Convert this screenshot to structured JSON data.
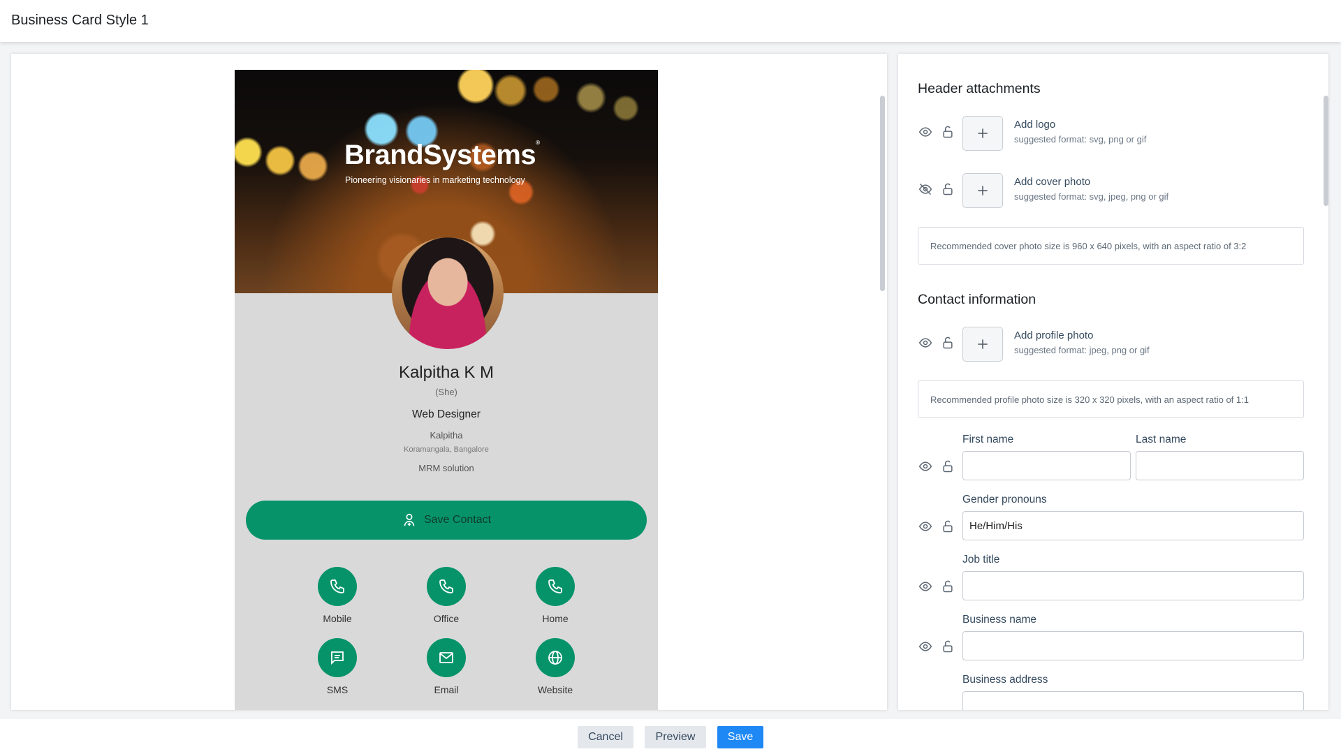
{
  "app": {
    "title": "Business Card Style 1"
  },
  "card": {
    "brand_name": "BrandSystems",
    "brand_mark": "®",
    "tagline": "Pioneering visionaries in marketing technology",
    "name": "Kalpitha K M",
    "pronouns": "(She)",
    "job_title": "Web Designer",
    "business": "Kalpitha",
    "address": "Koramangala, Bangalore",
    "department": "MRM solution",
    "save_contact": "Save Contact",
    "accent_color": "#07936a",
    "actions": [
      {
        "label": "Mobile",
        "icon": "phone-icon"
      },
      {
        "label": "Office",
        "icon": "phone-icon"
      },
      {
        "label": "Home",
        "icon": "phone-icon"
      },
      {
        "label": "SMS",
        "icon": "message-icon"
      },
      {
        "label": "Email",
        "icon": "mail-icon"
      },
      {
        "label": "Website",
        "icon": "globe-icon"
      }
    ]
  },
  "settings": {
    "header_section": "Header attachments",
    "logo": {
      "title": "Add logo",
      "sub": "suggested format: svg, png or gif",
      "visible": true
    },
    "cover": {
      "title": "Add cover photo",
      "sub": "suggested format: svg, jpeg, png or gif",
      "visible": false
    },
    "cover_note": "Recommended cover photo size is 960 x 640 pixels, with an aspect ratio of 3:2",
    "contact_section": "Contact information",
    "profile": {
      "title": "Add profile photo",
      "sub": "suggested format: jpeg, png or gif"
    },
    "profile_note": "Recommended profile photo size is 320 x 320 pixels, with an aspect ratio of 1:1",
    "fields": {
      "first_name": {
        "label": "First name",
        "value": ""
      },
      "last_name": {
        "label": "Last name",
        "value": ""
      },
      "gender_pronouns": {
        "label": "Gender pronouns",
        "value": "He/Him/His"
      },
      "job_title": {
        "label": "Job title",
        "value": ""
      },
      "business_name": {
        "label": "Business name",
        "value": ""
      },
      "business_address": {
        "label": "Business address",
        "value": ""
      }
    }
  },
  "footer": {
    "cancel": "Cancel",
    "preview": "Preview",
    "save": "Save"
  }
}
